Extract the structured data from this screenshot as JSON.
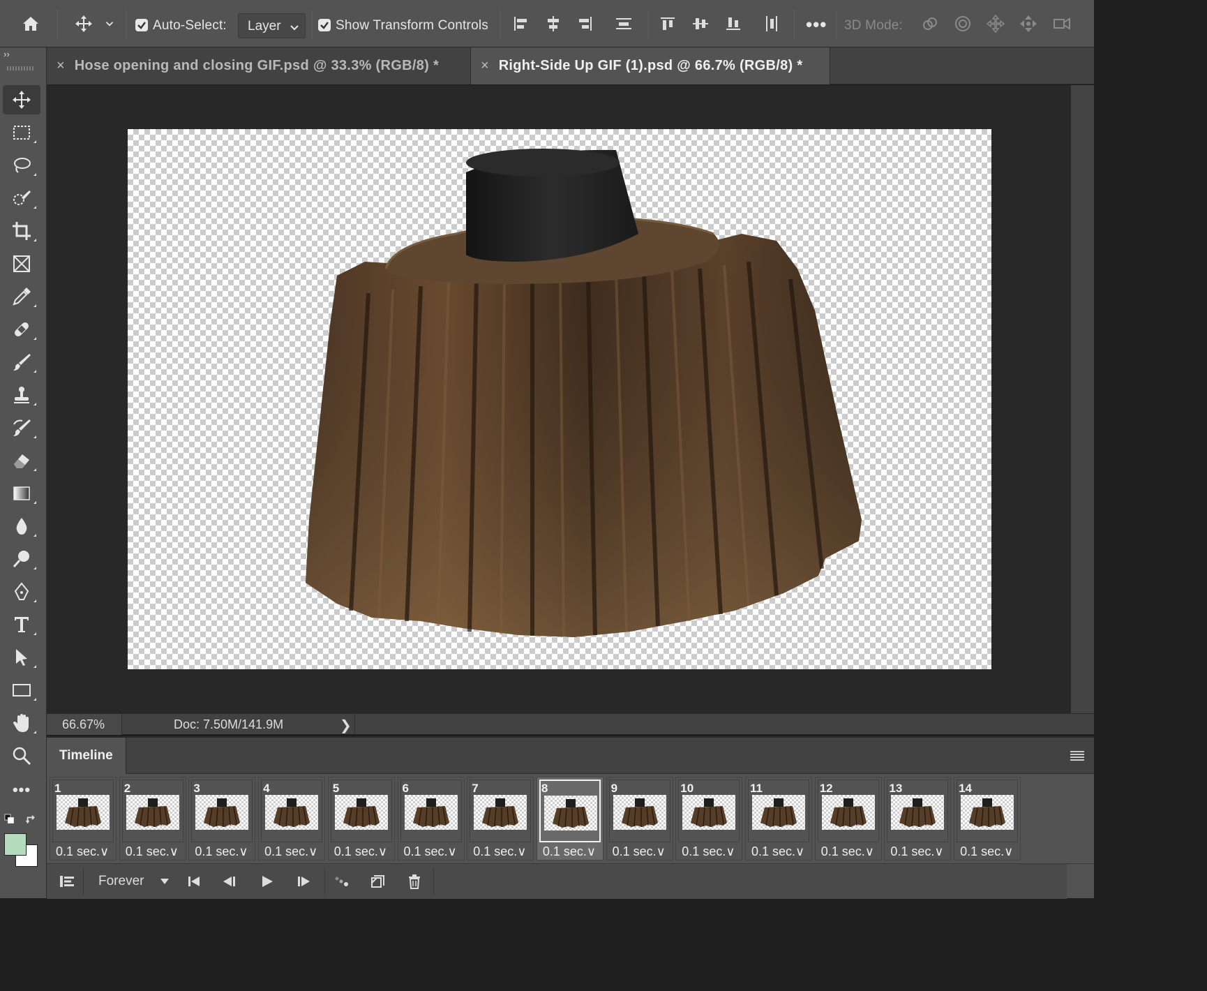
{
  "options_bar": {
    "auto_select_label": "Auto-Select:",
    "auto_select_checked": true,
    "auto_select_value": "Layer",
    "show_transform_label": "Show Transform Controls",
    "show_transform_checked": true,
    "more_label": "•••",
    "mode_3d_label": "3D Mode:",
    "icons": [
      "home-icon",
      "move-tool-icon",
      "chevron-down-icon",
      "align-left-icon",
      "align-center-horizontal-icon",
      "align-right-icon",
      "distribute-horizontal-icon",
      "align-top-icon",
      "align-center-vertical-icon",
      "align-bottom-icon",
      "distribute-vertical-icon",
      "orbit-3d-icon",
      "roll-3d-icon",
      "pan-3d-icon",
      "slide-3d-icon",
      "camera-3d-icon"
    ]
  },
  "toolbar": {
    "collapse_label": "››",
    "tools": [
      "move-tool",
      "marquee-tool",
      "lasso-tool",
      "quick-selection-tool",
      "crop-tool",
      "frame-tool",
      "eyedropper-tool",
      "healing-brush-tool",
      "brush-tool",
      "clone-stamp-tool",
      "history-brush-tool",
      "eraser-tool",
      "gradient-tool",
      "blur-tool",
      "dodge-tool",
      "pen-tool",
      "type-tool",
      "path-selection-tool",
      "rectangle-tool",
      "hand-tool",
      "zoom-tool",
      "edit-toolbar"
    ],
    "active_tool": "move-tool",
    "more_label": "•••",
    "foreground_color": "#b5dcbf",
    "background_color": "#ffffff"
  },
  "tabs": [
    {
      "close": "×",
      "title": "Hose opening and closing GIF.psd @ 33.3% (RGB/8) *",
      "active": false
    },
    {
      "close": "×",
      "title": "Right-Side Up GIF (1).psd @ 66.7% (RGB/8) *",
      "active": true
    }
  ],
  "status": {
    "zoom": "66.67%",
    "doc_info": "Doc: 7.50M/141.9M",
    "arrow": "❯"
  },
  "timeline": {
    "title": "Timeline",
    "selected_frame": 8,
    "frames": [
      {
        "number": "1",
        "delay": "0.1 sec.∨"
      },
      {
        "number": "2",
        "delay": "0.1 sec.∨"
      },
      {
        "number": "3",
        "delay": "0.1 sec.∨"
      },
      {
        "number": "4",
        "delay": "0.1 sec.∨"
      },
      {
        "number": "5",
        "delay": "0.1 sec.∨"
      },
      {
        "number": "6",
        "delay": "0.1 sec.∨"
      },
      {
        "number": "7",
        "delay": "0.1 sec.∨"
      },
      {
        "number": "8",
        "delay": "0.1 sec.∨"
      },
      {
        "number": "9",
        "delay": "0.1 sec.∨"
      },
      {
        "number": "10",
        "delay": "0.1 sec.∨"
      },
      {
        "number": "11",
        "delay": "0.1 sec.∨"
      },
      {
        "number": "12",
        "delay": "0.1 sec.∨"
      },
      {
        "number": "13",
        "delay": "0.1 sec.∨"
      },
      {
        "number": "14",
        "delay": "0.1 sec.∨"
      }
    ],
    "loop_value": "Forever",
    "controls": [
      "convert-to-video-timeline-icon",
      "first-frame-icon",
      "previous-frame-icon",
      "play-icon",
      "next-frame-icon",
      "tween-icon",
      "duplicate-frame-icon",
      "delete-frame-icon"
    ]
  },
  "colors": {
    "panel_bg": "#535353",
    "canvas_bg": "#282828",
    "wood_dark": "#3a2a1c",
    "wood_mid": "#5a412b",
    "cap_black": "#1e1e1e"
  }
}
